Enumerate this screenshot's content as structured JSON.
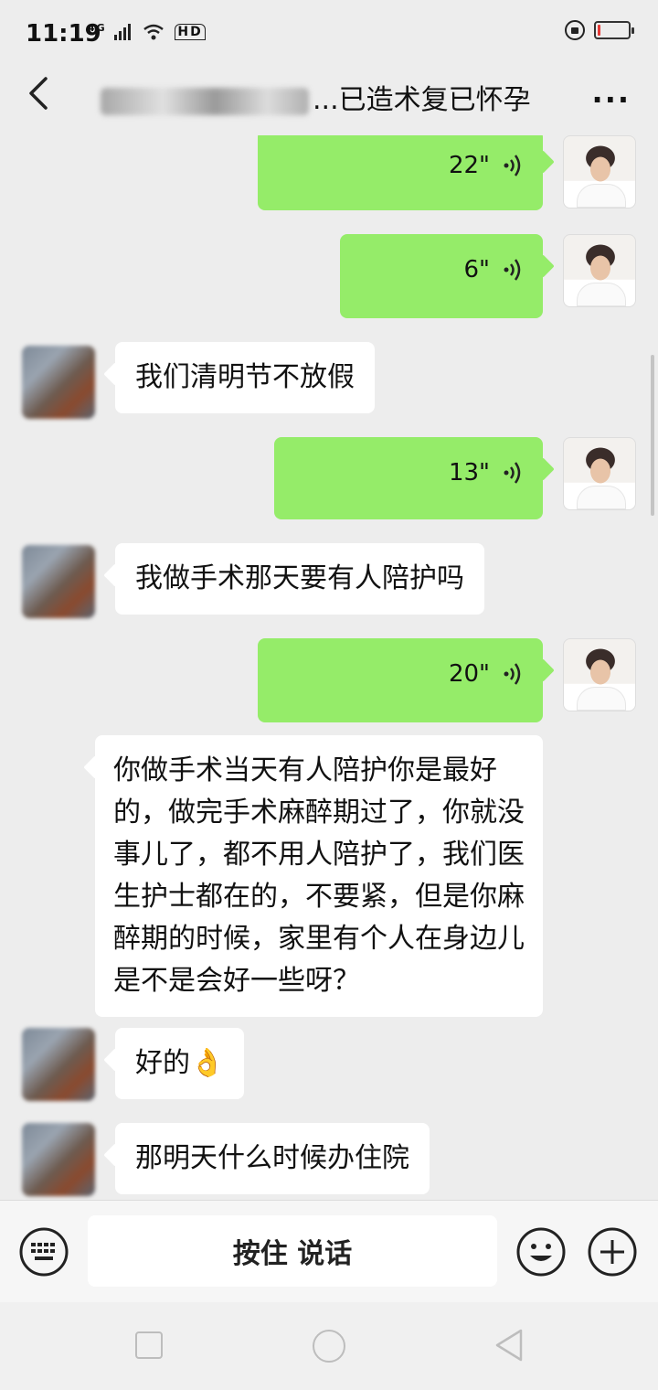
{
  "status_bar": {
    "time": "11:19",
    "network": "4G",
    "hd": "HD"
  },
  "header": {
    "title_visible": "...已造术复已怀孕",
    "more": "···"
  },
  "messages": [
    {
      "side": "out",
      "type": "voice",
      "duration": "22\""
    },
    {
      "side": "out",
      "type": "voice",
      "duration": "6\""
    },
    {
      "side": "in",
      "type": "text",
      "text": "我们清明节不放假"
    },
    {
      "side": "out",
      "type": "voice",
      "duration": "13\""
    },
    {
      "side": "in",
      "type": "text",
      "text": "我做手术那天要有人陪护吗"
    },
    {
      "side": "out",
      "type": "voice",
      "duration": "20\""
    },
    {
      "side": "in",
      "type": "text",
      "text": "你做手术当天有人陪护你是最好的，做完手术麻醉期过了，你就没事儿了，都不用人陪护了，我们医生护士都在的，不要紧，但是你麻醉期的时候，家里有个人在身边儿是不是会好一些呀？"
    },
    {
      "side": "in",
      "type": "text",
      "text": "好的👌"
    },
    {
      "side": "in",
      "type": "text",
      "text": "那明天什么时候办住院"
    }
  ],
  "input_bar": {
    "talk_label": "按住 说话"
  },
  "colors": {
    "out_bubble": "#95ec69",
    "in_bubble": "#ffffff",
    "background": "#ededed",
    "battery_low": "#e53935"
  },
  "status": {
    "battery_level": 0.1
  },
  "icons": [
    "back-icon",
    "more-icon",
    "voice-icon",
    "keyboard-icon",
    "emoji-icon",
    "plus-icon",
    "nav-square-icon",
    "nav-home-icon",
    "nav-back-icon"
  ]
}
